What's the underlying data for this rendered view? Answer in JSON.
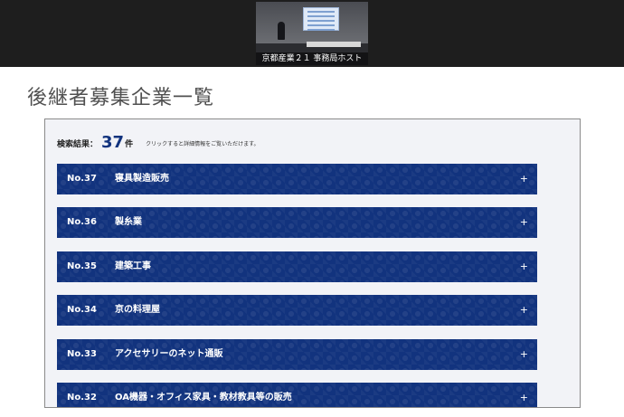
{
  "video": {
    "participant_name": "京都産業２１ 事務局ホスト"
  },
  "slide": {
    "title": "後継者募集企業一覧"
  },
  "results": {
    "label": "検索結果：",
    "count": "37",
    "unit": "件",
    "hint": "クリックすると詳細情報をご覧いただけます。"
  },
  "items": [
    {
      "no": "No.37",
      "name": "寝具製造販売",
      "icon": "plus-icon"
    },
    {
      "no": "No.36",
      "name": "製糸業",
      "icon": "plus-icon"
    },
    {
      "no": "No.35",
      "name": "建築工事",
      "icon": "plus-icon"
    },
    {
      "no": "No.34",
      "name": "京の料理屋",
      "icon": "plus-icon"
    },
    {
      "no": "No.33",
      "name": "アクセサリーのネット通販",
      "icon": "plus-icon"
    },
    {
      "no": "No.32",
      "name": "OA機器・オフィス家具・教材教具等の販売",
      "icon": "plus-icon"
    }
  ],
  "colors": {
    "accent": "#12337e",
    "topbar": "#1e1e1e",
    "panel_bg": "#f2f3f7"
  }
}
